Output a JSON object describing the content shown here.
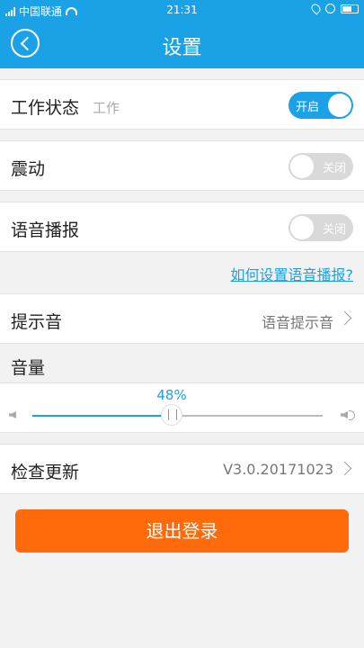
{
  "status_bar": {
    "carrier": "中国联通",
    "time": "21:31",
    "icons": [
      "signal-icon",
      "wifi-icon",
      "location-icon",
      "alarm-icon",
      "battery-icon"
    ]
  },
  "nav": {
    "title": "设置",
    "back_icon": "back-circle-icon"
  },
  "work_status": {
    "label": "工作状态",
    "current": "工作",
    "toggle_text": "开启",
    "enabled": true
  },
  "vibration": {
    "label": "震动",
    "toggle_text": "关闭",
    "enabled": false
  },
  "voice_broadcast": {
    "label": "语音播报",
    "toggle_text": "关闭",
    "enabled": false
  },
  "help_link": "如何设置语音播报?",
  "prompt_sound": {
    "label": "提示音",
    "value": "语音提示音"
  },
  "volume": {
    "label": "音量",
    "percent_text": "48%",
    "value": 0.48
  },
  "check_update": {
    "label": "检查更新",
    "version": "V3.0.20171023"
  },
  "logout_label": "退出登录",
  "colors": {
    "brand_blue": "#1aa1e6",
    "logout_orange": "#ff6a0a",
    "toggle_off": "#d9d9d9"
  }
}
